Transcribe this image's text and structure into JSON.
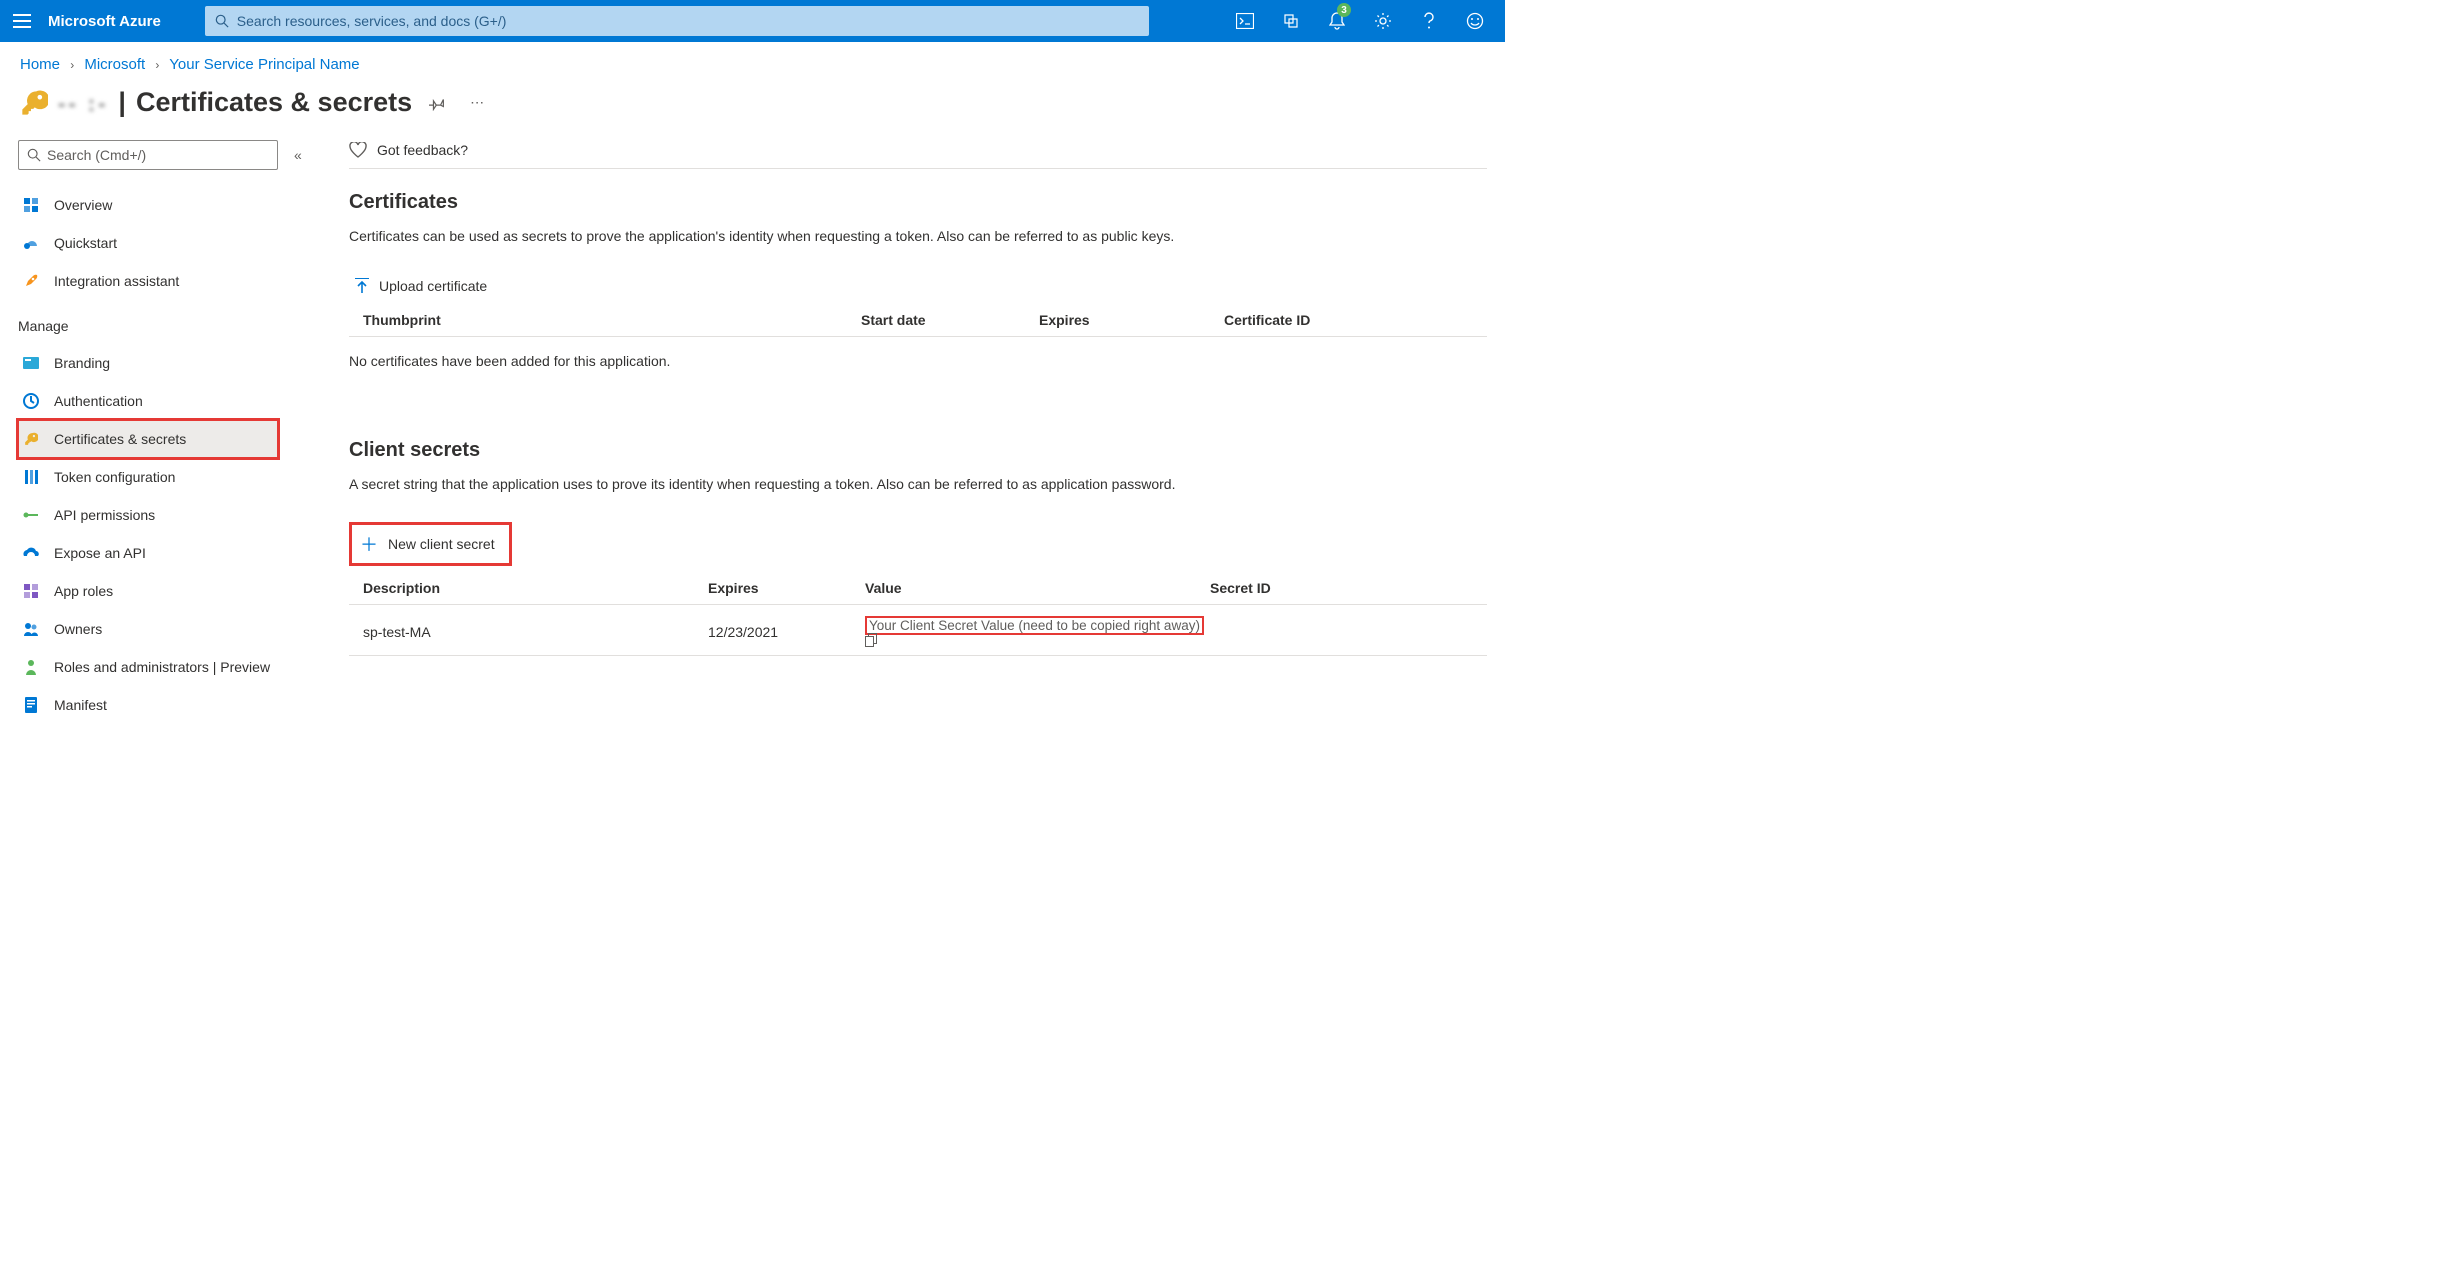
{
  "brand": "Microsoft Azure",
  "search_placeholder": "Search resources, services, and docs (G+/)",
  "notification_count": "3",
  "breadcrumbs": {
    "home": "Home",
    "item1": "Microsoft",
    "item2": "Your Service Principal Name"
  },
  "page_title": {
    "blurred_prefix": "-- :-",
    "separator": "|",
    "main": "Certificates & secrets"
  },
  "sidebar": {
    "search_placeholder": "Search (Cmd+/)",
    "items": [
      {
        "label": "Overview",
        "icon": "overview"
      },
      {
        "label": "Quickstart",
        "icon": "quickstart"
      },
      {
        "label": "Integration assistant",
        "icon": "rocket"
      }
    ],
    "manage_label": "Manage",
    "manage_items": [
      {
        "label": "Branding",
        "icon": "branding"
      },
      {
        "label": "Authentication",
        "icon": "auth"
      },
      {
        "label": "Certificates & secrets",
        "icon": "key",
        "selected": true,
        "highlighted": true
      },
      {
        "label": "Token configuration",
        "icon": "token"
      },
      {
        "label": "API permissions",
        "icon": "api-perm"
      },
      {
        "label": "Expose an API",
        "icon": "expose-api"
      },
      {
        "label": "App roles",
        "icon": "app-roles"
      },
      {
        "label": "Owners",
        "icon": "owners"
      },
      {
        "label": "Roles and administrators | Preview",
        "icon": "roles-admin"
      },
      {
        "label": "Manifest",
        "icon": "manifest"
      }
    ]
  },
  "feedback_label": "Got feedback?",
  "certificates": {
    "heading": "Certificates",
    "description": "Certificates can be used as secrets to prove the application's identity when requesting a token. Also can be referred to as public keys.",
    "upload_label": "Upload certificate",
    "columns": {
      "thumbprint": "Thumbprint",
      "start_date": "Start date",
      "expires": "Expires",
      "certificate_id": "Certificate ID"
    },
    "empty": "No certificates have been added for this application."
  },
  "client_secrets": {
    "heading": "Client secrets",
    "description": "A secret string that the application uses to prove its identity when requesting a token. Also can be referred to as application password.",
    "new_label": "New client secret",
    "columns": {
      "description": "Description",
      "expires": "Expires",
      "value": "Value",
      "secret_id": "Secret ID"
    },
    "rows": [
      {
        "description": "sp-test-MA",
        "expires": "12/23/2021",
        "value": "Your Client Secret Value (need to be copied right away)",
        "secret_id": ""
      }
    ]
  },
  "colors": {
    "azure_blue": "#0078d4",
    "highlight_red": "#e53935"
  }
}
